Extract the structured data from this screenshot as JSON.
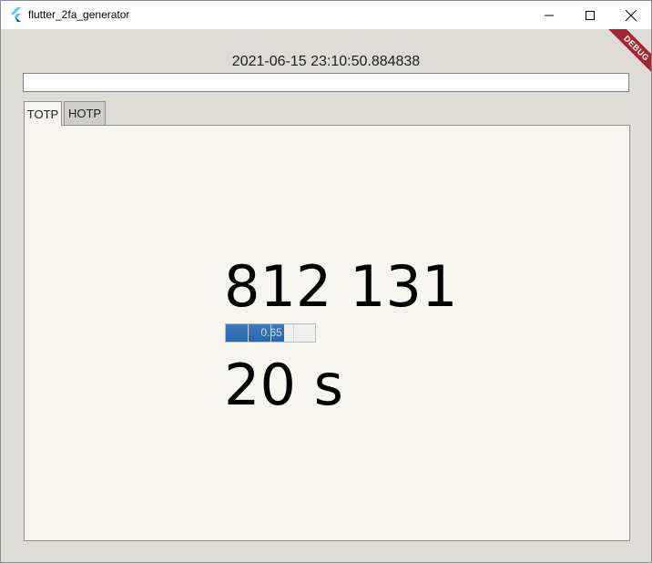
{
  "window": {
    "title": "flutter_2fa_generator",
    "icon": "flutter-logo-icon",
    "controls": [
      "minimize-icon",
      "maximize-icon",
      "close-icon"
    ]
  },
  "debug_banner": "DEBUG",
  "timestamp": "2021-06-15 23:10:50.884838",
  "secret_input": {
    "value": "",
    "placeholder": ""
  },
  "tabs": [
    {
      "label": "TOTP",
      "selected": true
    },
    {
      "label": "HOTP",
      "selected": false
    }
  ],
  "totp": {
    "code": "812 131",
    "progress": {
      "value": 0.65,
      "label": "0.65"
    },
    "remaining": "20 s"
  },
  "colors": {
    "accent": "#2a66aa",
    "panel_background": "#f7f5f0",
    "window_background": "#dedcd7",
    "debug_banner": "#a52530"
  }
}
